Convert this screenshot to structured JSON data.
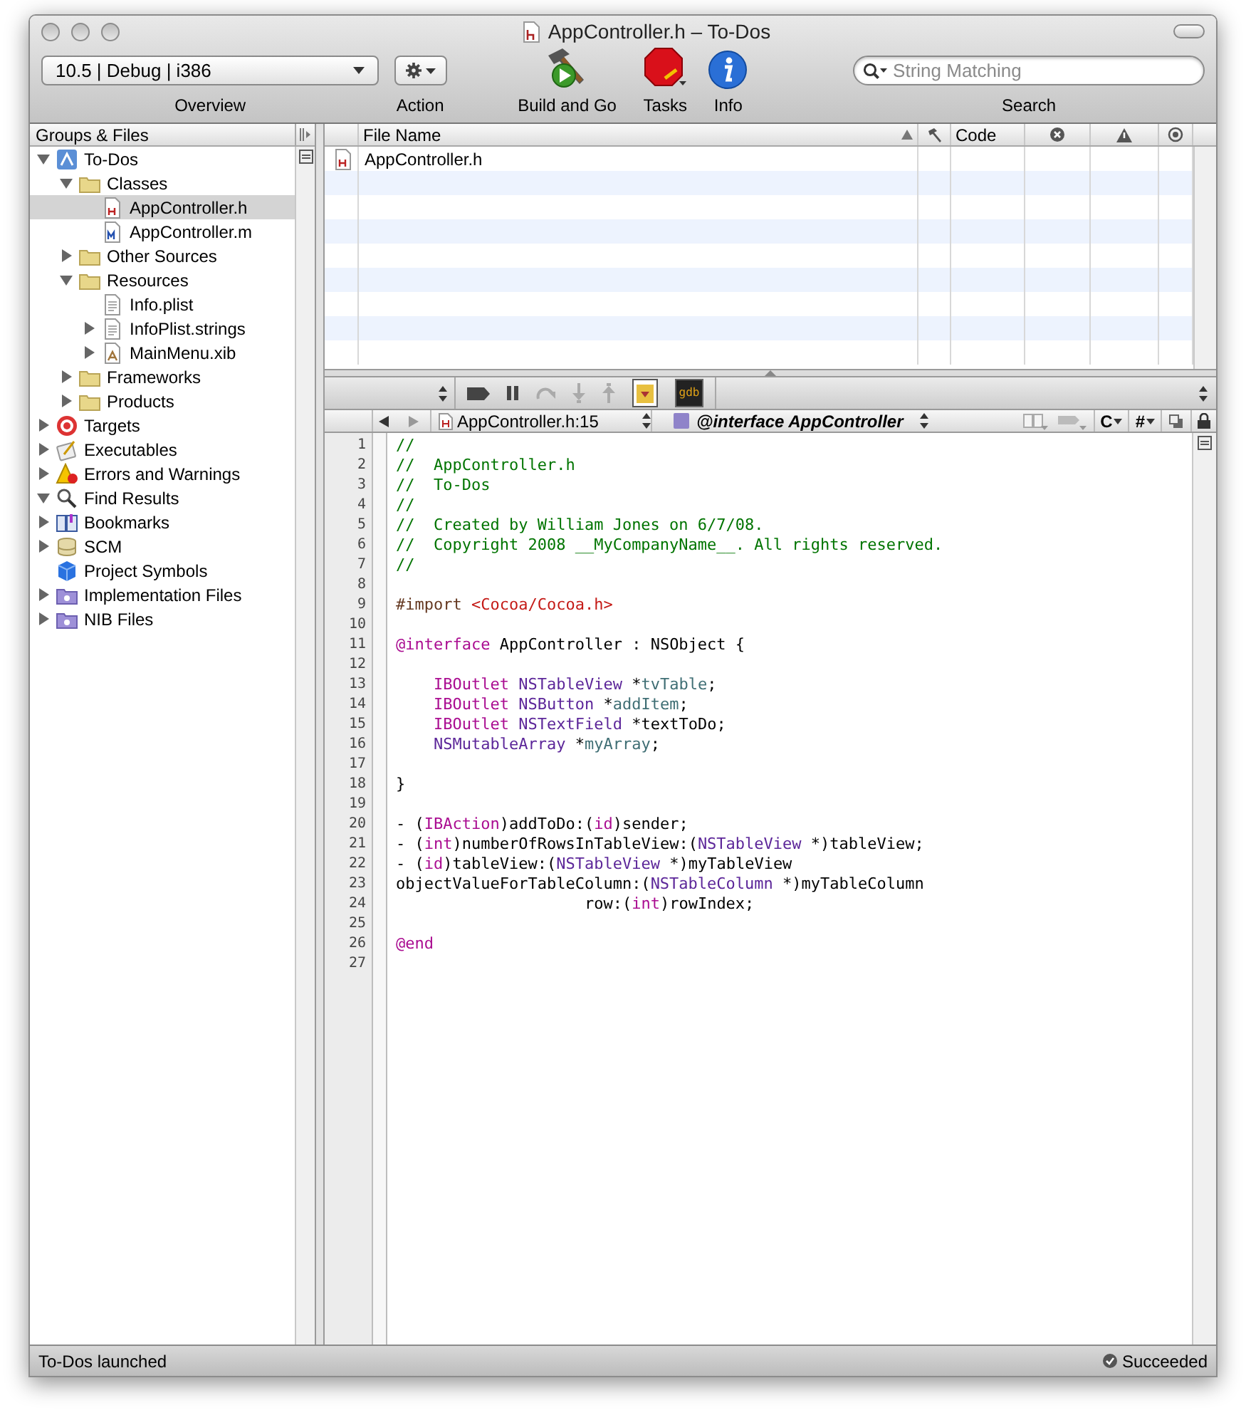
{
  "window": {
    "title": "AppController.h – To-Dos"
  },
  "toolbar": {
    "configuration": "10.5 | Debug | i386",
    "overview_label": "Overview",
    "action_label": "Action",
    "build_label": "Build and Go",
    "tasks_label": "Tasks",
    "info_label": "Info",
    "search": {
      "placeholder": "String Matching"
    },
    "search_label": "Search"
  },
  "sidebar": {
    "title": "Groups & Files",
    "items": [
      {
        "label": "To-Dos",
        "kind": "project",
        "expanded": true,
        "selected": false,
        "children": [
          {
            "label": "Classes",
            "kind": "folder",
            "expanded": true,
            "selected": false,
            "children": [
              {
                "label": "AppController.h",
                "kind": "header",
                "selected": true
              },
              {
                "label": "AppController.m",
                "kind": "source",
                "selected": false
              }
            ]
          },
          {
            "label": "Other Sources",
            "kind": "folder",
            "expanded": false,
            "selected": false
          },
          {
            "label": "Resources",
            "kind": "folder",
            "expanded": true,
            "selected": false,
            "children": [
              {
                "label": "Info.plist",
                "kind": "plist",
                "selected": false
              },
              {
                "label": "InfoPlist.strings",
                "kind": "plist",
                "expanded": false,
                "selected": false
              },
              {
                "label": "MainMenu.xib",
                "kind": "xib",
                "expanded": false,
                "selected": false
              }
            ]
          },
          {
            "label": "Frameworks",
            "kind": "folder",
            "expanded": false,
            "selected": false
          },
          {
            "label": "Products",
            "kind": "folder",
            "expanded": false,
            "selected": false
          }
        ]
      },
      {
        "label": "Targets",
        "kind": "targets",
        "expanded": false,
        "selected": false
      },
      {
        "label": "Executables",
        "kind": "executables",
        "expanded": false,
        "selected": false
      },
      {
        "label": "Errors and Warnings",
        "kind": "errors",
        "expanded": false,
        "selected": false
      },
      {
        "label": "Find Results",
        "kind": "find",
        "expanded": true,
        "selected": false
      },
      {
        "label": "Bookmarks",
        "kind": "bookmarks",
        "expanded": false,
        "selected": false
      },
      {
        "label": "SCM",
        "kind": "scm",
        "expanded": false,
        "selected": false
      },
      {
        "label": "Project Symbols",
        "kind": "symbols",
        "selected": false
      },
      {
        "label": "Implementation Files",
        "kind": "smart",
        "expanded": false,
        "selected": false
      },
      {
        "label": "NIB Files",
        "kind": "smart",
        "expanded": false,
        "selected": false
      }
    ]
  },
  "file_list": {
    "columns": [
      {
        "kind": "icon"
      },
      {
        "kind": "text",
        "label": "File Name",
        "sorted": true
      },
      {
        "kind": "build"
      },
      {
        "kind": "text",
        "label": "Code"
      },
      {
        "kind": "errors"
      },
      {
        "kind": "warnings"
      },
      {
        "kind": "include"
      }
    ],
    "rows": [
      {
        "file": "AppController.h",
        "kind": "header"
      }
    ]
  },
  "debugger": {
    "console_label": "gdb"
  },
  "navigator": {
    "file": "AppController.h:15",
    "symbol": "@interface AppController",
    "language": "C",
    "includes": "#"
  },
  "editor": {
    "lines": [
      {
        "number": "1",
        "tokens": [
          {
            "kind": "comment",
            "text": "//"
          }
        ]
      },
      {
        "number": "2",
        "tokens": [
          {
            "kind": "comment",
            "text": "//  AppController.h"
          }
        ]
      },
      {
        "number": "3",
        "tokens": [
          {
            "kind": "comment",
            "text": "//  To-Dos"
          }
        ]
      },
      {
        "number": "4",
        "tokens": [
          {
            "kind": "comment",
            "text": "//"
          }
        ]
      },
      {
        "number": "5",
        "tokens": [
          {
            "kind": "comment",
            "text": "//  Created by William Jones on 6/7/08."
          }
        ]
      },
      {
        "number": "6",
        "tokens": [
          {
            "kind": "comment",
            "text": "//  Copyright 2008 __MyCompanyName__. All rights reserved."
          }
        ]
      },
      {
        "number": "7",
        "tokens": [
          {
            "kind": "comment",
            "text": "//"
          }
        ]
      },
      {
        "number": "8"
      },
      {
        "number": "9",
        "tokens": [
          {
            "kind": "preprocessor",
            "text": "#import "
          },
          {
            "kind": "string",
            "text": "<Cocoa/Cocoa.h>"
          }
        ]
      },
      {
        "number": "10"
      },
      {
        "number": "11",
        "tokens": [
          {
            "kind": "keyword",
            "text": "@interface"
          },
          {
            "kind": "plain",
            "text": " AppController : NSObject {"
          }
        ]
      },
      {
        "number": "12"
      },
      {
        "number": "13",
        "tokens": [
          {
            "kind": "keyword",
            "text": "    IBOutlet"
          },
          {
            "kind": "type",
            "text": " NSTableView"
          },
          {
            "kind": "plain",
            "text": " *"
          },
          {
            "kind": "ivar",
            "text": "tvTable"
          },
          {
            "kind": "plain",
            "text": ";"
          }
        ]
      },
      {
        "number": "14",
        "tokens": [
          {
            "kind": "keyword",
            "text": "    IBOutlet"
          },
          {
            "kind": "type",
            "text": " NSButton"
          },
          {
            "kind": "plain",
            "text": " *"
          },
          {
            "kind": "ivar",
            "text": "addItem"
          },
          {
            "kind": "plain",
            "text": ";"
          }
        ]
      },
      {
        "number": "15",
        "tokens": [
          {
            "kind": "keyword",
            "text": "    IBOutlet"
          },
          {
            "kind": "type",
            "text": " NSTextField"
          },
          {
            "kind": "plain",
            "text": " *textToDo;"
          }
        ]
      },
      {
        "number": "16",
        "tokens": [
          {
            "kind": "type",
            "text": "    NSMutableArray"
          },
          {
            "kind": "plain",
            "text": " *"
          },
          {
            "kind": "ivar",
            "text": "myArray"
          },
          {
            "kind": "plain",
            "text": ";"
          }
        ]
      },
      {
        "number": "17"
      },
      {
        "number": "18",
        "tokens": [
          {
            "kind": "plain",
            "text": "}"
          }
        ]
      },
      {
        "number": "19"
      },
      {
        "number": "20",
        "tokens": [
          {
            "kind": "plain",
            "text": "- ("
          },
          {
            "kind": "keyword",
            "text": "IBAction"
          },
          {
            "kind": "plain",
            "text": ")addToDo:("
          },
          {
            "kind": "keyword",
            "text": "id"
          },
          {
            "kind": "plain",
            "text": ")sender;"
          }
        ]
      },
      {
        "number": "21",
        "tokens": [
          {
            "kind": "plain",
            "text": "- ("
          },
          {
            "kind": "keyword",
            "text": "int"
          },
          {
            "kind": "plain",
            "text": ")numberOfRowsInTableView:("
          },
          {
            "kind": "type",
            "text": "NSTableView"
          },
          {
            "kind": "plain",
            "text": " *)tableView;"
          }
        ]
      },
      {
        "number": "22",
        "tokens": [
          {
            "kind": "plain",
            "text": "- ("
          },
          {
            "kind": "keyword",
            "text": "id"
          },
          {
            "kind": "plain",
            "text": ")tableView:("
          },
          {
            "kind": "type",
            "text": "NSTableView"
          },
          {
            "kind": "plain",
            "text": " *)myTableView"
          }
        ]
      },
      {
        "number": "23",
        "tokens": [
          {
            "kind": "plain",
            "text": "objectValueForTableColumn:("
          },
          {
            "kind": "type",
            "text": "NSTableColumn"
          },
          {
            "kind": "plain",
            "text": " *)myTableColumn"
          }
        ]
      },
      {
        "number": "24",
        "tokens": [
          {
            "kind": "plain",
            "text": "                    row:("
          },
          {
            "kind": "keyword",
            "text": "int"
          },
          {
            "kind": "plain",
            "text": ")rowIndex;"
          }
        ]
      },
      {
        "number": "25"
      },
      {
        "number": "26",
        "tokens": [
          {
            "kind": "keyword",
            "text": "@end"
          }
        ]
      },
      {
        "number": "27"
      }
    ]
  },
  "status_bar": {
    "message": "To-Dos launched",
    "result": "Succeeded"
  }
}
